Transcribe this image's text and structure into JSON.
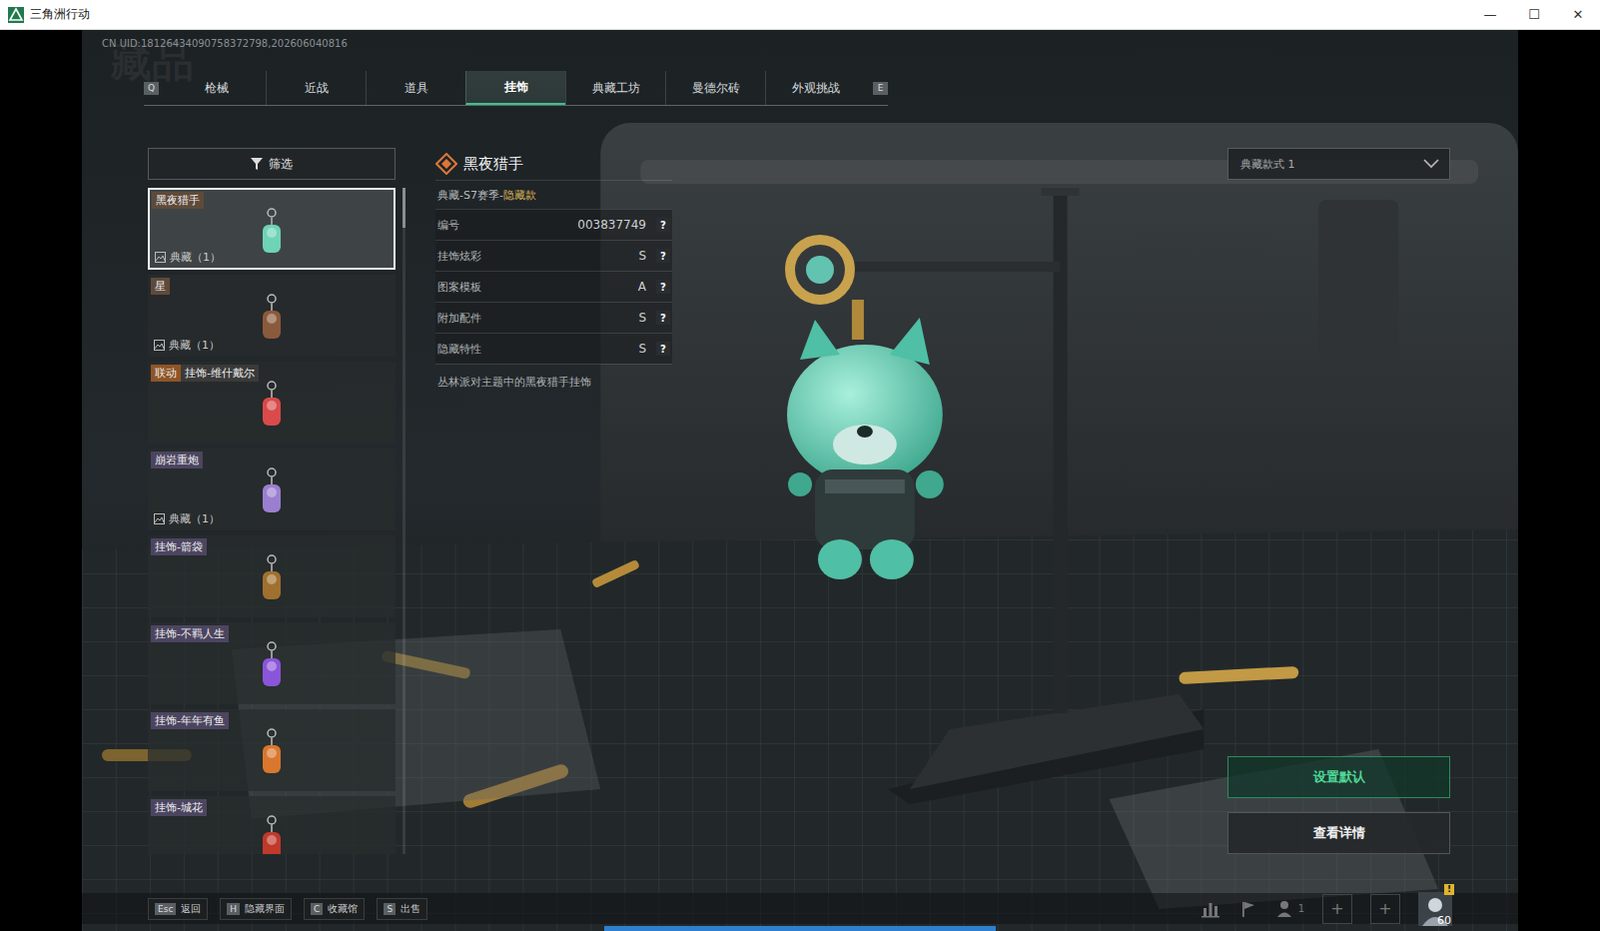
{
  "window": {
    "title": "三角洲行动",
    "controls": [
      "—",
      "☐",
      "✕"
    ]
  },
  "uid": "CN UID:18126434090758372798,202606040816",
  "watermark": "藏品",
  "tab_keys": {
    "prev": "Q",
    "next": "E"
  },
  "tabs": [
    {
      "label": "枪械",
      "selected": false
    },
    {
      "label": "近战",
      "selected": false
    },
    {
      "label": "道具",
      "selected": false
    },
    {
      "label": "挂饰",
      "selected": true
    },
    {
      "label": "典藏工坊",
      "selected": false
    },
    {
      "label": "曼德尔砖",
      "selected": false
    },
    {
      "label": "外观挑战",
      "selected": false
    }
  ],
  "filter": {
    "label": "筛选"
  },
  "items": [
    {
      "label": "黑夜猎手",
      "label_color": "#5e4a3a",
      "footer": "典藏（1）",
      "thumb_color": "#6fd3b8",
      "selected": true
    },
    {
      "label": "星",
      "label_color": "#5e4a3a",
      "footer": "典藏（1）",
      "thumb_color": "#8a5a3c",
      "selected": false
    },
    {
      "badge": {
        "text": "联动",
        "color": "#8f5526"
      },
      "label": "挂饰-维什戴尔",
      "label_color": "#3a3a3a",
      "thumb_color": "#d94a4a",
      "selected": false
    },
    {
      "label": "崩岩重炮",
      "label_color": "#4c4560",
      "footer": "典藏（1）",
      "thumb_color": "#9a7fd0",
      "selected": false
    },
    {
      "label": "挂饰-箭袋",
      "label_color": "#4c4560",
      "thumb_color": "#a0702f",
      "selected": false
    },
    {
      "label": "挂饰-不羁人生",
      "label_color": "#4c4560",
      "thumb_color": "#8a55d8",
      "selected": false
    },
    {
      "label": "挂饰-年年有鱼",
      "label_color": "#4c4560",
      "thumb_color": "#d9772e",
      "selected": false
    },
    {
      "label": "挂饰-城花",
      "label_color": "#4c4560",
      "thumb_color": "#c0392b",
      "selected": false
    }
  ],
  "detail": {
    "title": "黑夜猎手",
    "rarity_prefix": "典藏-S7赛季-",
    "rarity_highlight": "隐藏款",
    "rows": [
      {
        "label": "编号",
        "value": "003837749",
        "help": "?"
      },
      {
        "label": "挂饰炫彩",
        "value": "S",
        "help": "?"
      },
      {
        "label": "图案模板",
        "value": "A",
        "help": "?"
      },
      {
        "label": "附加配件",
        "value": "S",
        "help": "?"
      },
      {
        "label": "隐藏特性",
        "value": "S",
        "help": "?"
      }
    ],
    "description": "丛林派对主题中的黑夜猎手挂饰"
  },
  "style_select": {
    "value": "典藏款式 1"
  },
  "actions": [
    {
      "label": "设置默认",
      "primary": true
    },
    {
      "label": "查看详情",
      "primary": false
    }
  ],
  "hints": [
    {
      "key": "Esc",
      "label": "返回"
    },
    {
      "key": "H",
      "label": "隐藏界面"
    },
    {
      "key": "C",
      "label": "收藏馆"
    },
    {
      "key": "S",
      "label": "出售"
    }
  ],
  "status": {
    "party_count": "1",
    "add_slots": [
      "+",
      "+"
    ],
    "level": "60",
    "alert": "!"
  }
}
